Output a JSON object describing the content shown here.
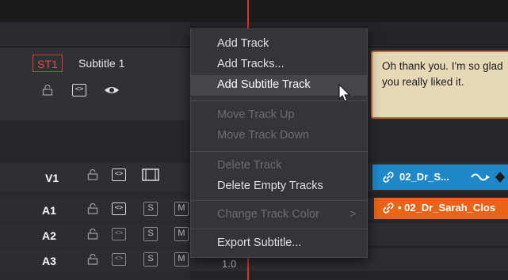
{
  "subtitle_track": {
    "badge": "ST1",
    "name": "Subtitle 1",
    "clip_text": "Oh thank you. I'm so glad you really liked it."
  },
  "tracks": [
    {
      "label": "V1"
    },
    {
      "label": "A1"
    },
    {
      "label": "A2"
    },
    {
      "label": "A3"
    }
  ],
  "buttons": {
    "solo": "S",
    "mute": "M"
  },
  "audio_level_value": "1.0",
  "clips": {
    "video": "02_Dr_S...",
    "audio": "• 02_Dr_Sarah_Clos"
  },
  "context_menu": {
    "items": [
      {
        "label": "Add Track",
        "enabled": true
      },
      {
        "label": "Add Tracks...",
        "enabled": true
      },
      {
        "label": "Add Subtitle Track",
        "enabled": true,
        "highlighted": true
      },
      {
        "label": "Move Track Up",
        "enabled": false
      },
      {
        "label": "Move Track Down",
        "enabled": false
      },
      {
        "label": "Delete Track",
        "enabled": false
      },
      {
        "label": "Delete Empty Tracks",
        "enabled": true
      },
      {
        "label": "Change Track Color",
        "enabled": false,
        "submenu_glyph": ">"
      },
      {
        "label": "Export Subtitle...",
        "enabled": true
      }
    ]
  },
  "colors": {
    "playhead": "#d7342d",
    "subtitle_clip": "#e7d8b6",
    "video_clip": "#1e88c8",
    "audio_clip": "#e86419"
  }
}
